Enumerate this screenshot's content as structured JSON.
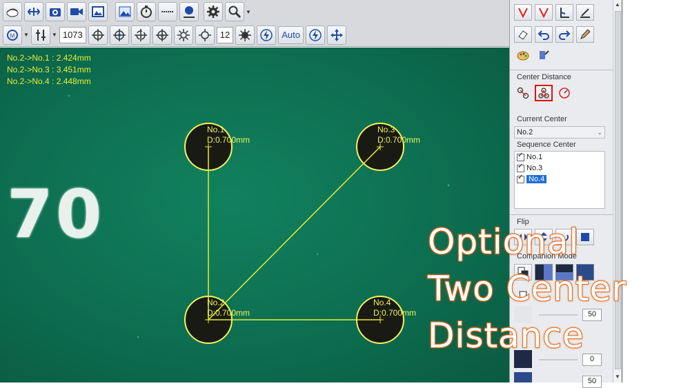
{
  "toolbar2": {
    "exposure_value": "1073",
    "gain_value": "12",
    "auto_label": "Auto"
  },
  "readouts": [
    "No.2->No.1 : 2.424mm",
    "No.2->No.3 : 3.451mm",
    "No.2->No.4 : 2.448mm"
  ],
  "board_marking": "70",
  "holes": [
    {
      "name": "No.1",
      "diameter": "D:0.700mm"
    },
    {
      "name": "No.3",
      "diameter": "D:0.700mm"
    },
    {
      "name": "No.2",
      "diameter": "D:0.700mm"
    },
    {
      "name": "No.4",
      "diameter": "D:0.700mm"
    }
  ],
  "panel": {
    "center_distance_title": "Center Distance",
    "current_center_label": "Current Center",
    "current_center_value": "No.2",
    "sequence_center_label": "Sequence Center",
    "sequence_items": [
      "No.1",
      "No.3",
      "No.4"
    ],
    "flip_label": "Flip",
    "companion_mode_label": "Companion Mode",
    "values": [
      "50",
      "0",
      "50"
    ]
  },
  "caption": {
    "line1": "Optional",
    "line2": "Two Center",
    "line3": "Distance"
  },
  "colors": {
    "board": "#0d6e50",
    "measure": "#e8ee35",
    "highlight": "#e01010",
    "caption_outline": "#e46a1c",
    "selection": "#1f6fd6"
  }
}
